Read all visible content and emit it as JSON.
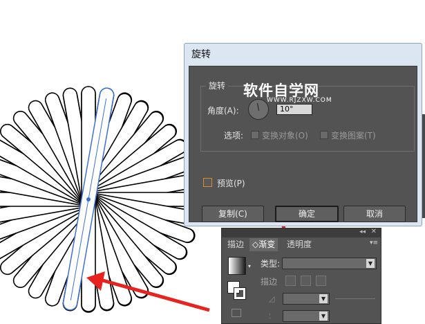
{
  "dialog": {
    "title": "旋转",
    "group_title": "旋转",
    "angle_label": "角度(A):",
    "angle_value": "10°",
    "options_label": "选项:",
    "option_objects": "变换对象(O)",
    "option_pattern": "变换图案(T)",
    "preview_label": "预览(P)",
    "copy_button": "复制(C)",
    "ok_button": "确定",
    "cancel_button": "取消"
  },
  "watermark": {
    "title": "软件自学网",
    "url": "WWW.RJZXW.COM"
  },
  "panel": {
    "tabs": [
      "描边",
      "◇渐变",
      "透明度"
    ],
    "type_label": "类型:",
    "stroke_label": "描边"
  },
  "colors": {
    "arrow": "#e8231f",
    "selection": "#3b6fd6",
    "dialog_body": "#535353"
  }
}
